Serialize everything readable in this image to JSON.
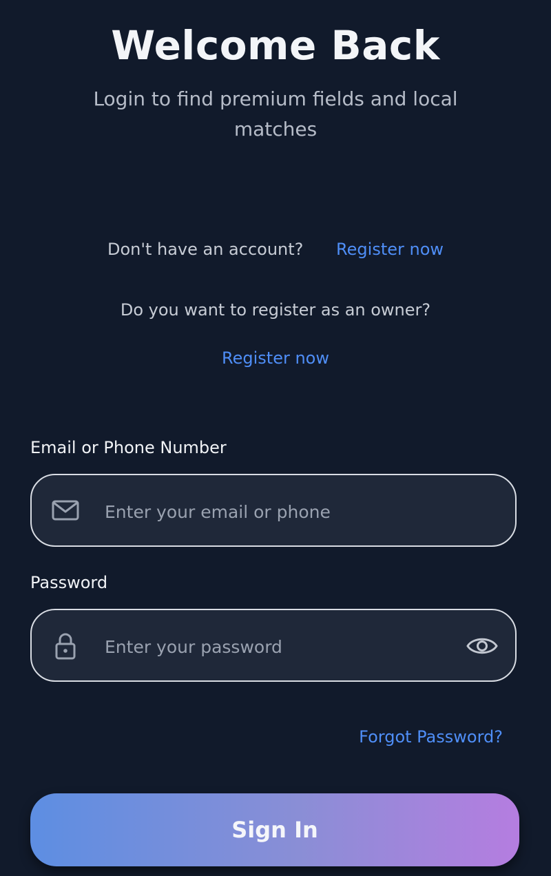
{
  "header": {
    "title": "Welcome Back",
    "subtitle": "Login to find premium fields and local matches"
  },
  "register": {
    "prompt": "Don't have an account?",
    "link": "Register now",
    "owner_prompt": "Do you want to register as an owner?",
    "owner_link": "Register now"
  },
  "form": {
    "email_label": "Email or Phone Number",
    "email_placeholder": "Enter your email or phone",
    "email_icon": "mail-icon",
    "password_label": "Password",
    "password_placeholder": "Enter your password",
    "password_icon": "lock-icon",
    "visibility_icon": "eye-icon",
    "forgot_label": "Forgot Password?",
    "signin_label": "Sign In"
  },
  "colors": {
    "background": "#111a2b",
    "link": "#4f8ef7",
    "button_gradient_start": "#5d8ee2",
    "button_gradient_end": "#b57de0"
  }
}
